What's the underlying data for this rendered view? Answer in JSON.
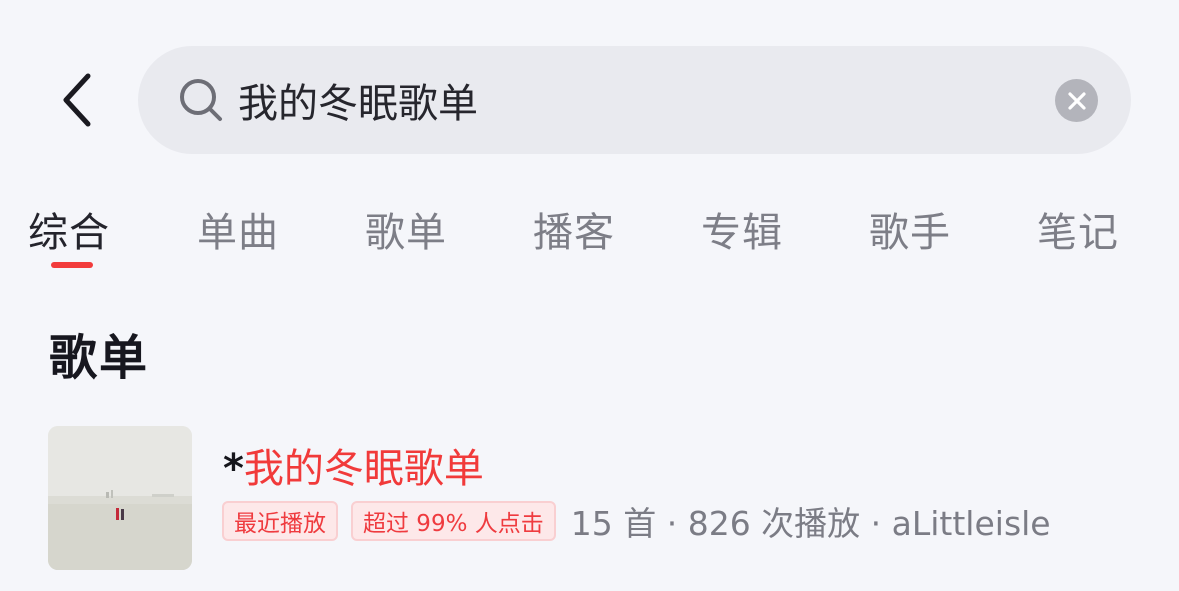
{
  "search": {
    "value": "我的冬眠歌单"
  },
  "tabs": [
    {
      "label": "综合",
      "active": true
    },
    {
      "label": "单曲",
      "active": false
    },
    {
      "label": "歌单",
      "active": false
    },
    {
      "label": "播客",
      "active": false
    },
    {
      "label": "专辑",
      "active": false
    },
    {
      "label": "歌手",
      "active": false
    },
    {
      "label": "笔记",
      "active": false
    }
  ],
  "section": {
    "title": "歌单"
  },
  "results": [
    {
      "title_prefix": "*",
      "title_highlight": "我的冬眠歌单",
      "tags": [
        "最近播放",
        "超过 99% 人点击"
      ],
      "meta": "15 首 · 826 次播放 · aLittleisle"
    }
  ],
  "colors": {
    "accent": "#f23b3b",
    "background": "#f5f6fa",
    "search_bg": "#e9eaef",
    "tag_bg": "#fde8e9",
    "text_muted": "#7b7c85"
  },
  "icons": [
    "back-chevron-icon",
    "search-icon",
    "clear-icon"
  ]
}
